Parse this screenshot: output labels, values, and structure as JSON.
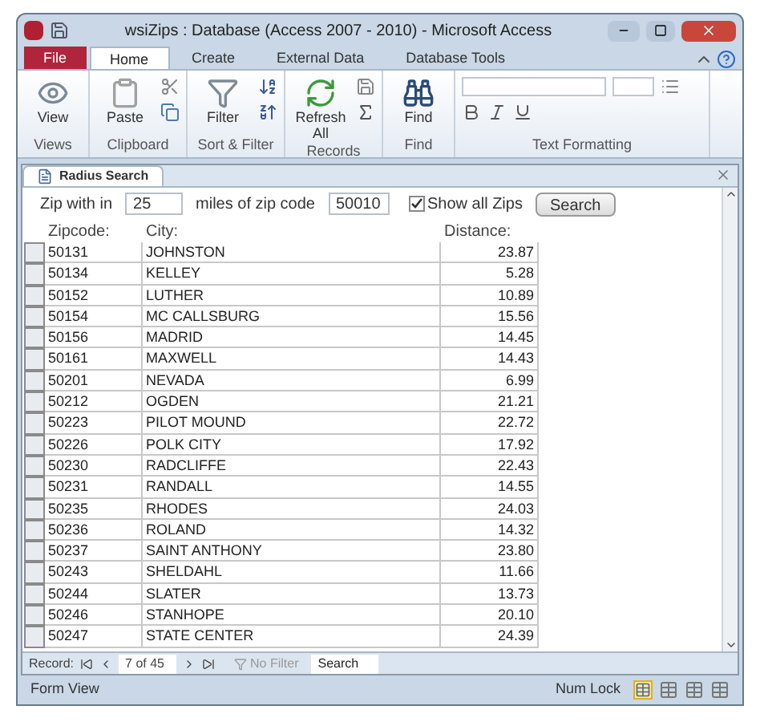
{
  "window": {
    "title": "wsiZips : Database (Access 2007 - 2010)  -  Microsoft Access"
  },
  "ribbon_tabs": [
    {
      "label": "File",
      "kind": "file",
      "selected": false
    },
    {
      "label": "Home",
      "kind": "tab",
      "selected": true
    },
    {
      "label": "Create",
      "kind": "tab",
      "selected": false
    },
    {
      "label": "External Data",
      "kind": "tab",
      "selected": false
    },
    {
      "label": "Database Tools",
      "kind": "tab",
      "selected": false
    }
  ],
  "ribbon_groups": [
    {
      "label": "Views",
      "button": "View",
      "kind": "view"
    },
    {
      "label": "Clipboard",
      "button": "Paste",
      "kind": "paste"
    },
    {
      "label": "Sort & Filter",
      "button": "Filter",
      "kind": "filter"
    },
    {
      "label": "Records",
      "button": "Refresh All",
      "kind": "refresh"
    },
    {
      "label": "Find",
      "button": "Find",
      "kind": "find"
    },
    {
      "label": "Text Formatting",
      "kind": "text"
    }
  ],
  "document_tab": {
    "label": "Radius Search"
  },
  "form": {
    "zip_within_label": "Zip with in",
    "miles_value": "25",
    "miles_label": "miles of zip code",
    "zip_value": "50010",
    "show_all": {
      "label": "Show all Zips",
      "checked": true
    },
    "search_button": "Search"
  },
  "table": {
    "columns": [
      "Zipcode:",
      "City:",
      "Distance:"
    ],
    "rows": [
      [
        "50131",
        "JOHNSTON",
        "23.87"
      ],
      [
        "50134",
        "KELLEY",
        "5.28"
      ],
      [
        "50152",
        "LUTHER",
        "10.89"
      ],
      [
        "50154",
        "MC CALLSBURG",
        "15.56"
      ],
      [
        "50156",
        "MADRID",
        "14.45"
      ],
      [
        "50161",
        "MAXWELL",
        "14.43"
      ],
      [
        "50201",
        "NEVADA",
        "6.99"
      ],
      [
        "50212",
        "OGDEN",
        "21.21"
      ],
      [
        "50223",
        "PILOT MOUND",
        "22.72"
      ],
      [
        "50226",
        "POLK CITY",
        "17.92"
      ],
      [
        "50230",
        "RADCLIFFE",
        "22.43"
      ],
      [
        "50231",
        "RANDALL",
        "14.55"
      ],
      [
        "50235",
        "RHODES",
        "24.03"
      ],
      [
        "50236",
        "ROLAND",
        "14.32"
      ],
      [
        "50237",
        "SAINT ANTHONY",
        "23.80"
      ],
      [
        "50243",
        "SHELDAHL",
        "11.66"
      ],
      [
        "50244",
        "SLATER",
        "13.73"
      ],
      [
        "50246",
        "STANHOPE",
        "20.10"
      ],
      [
        "50247",
        "STATE CENTER",
        "24.39"
      ]
    ]
  },
  "navigation": {
    "label": "Record:",
    "position": "7 of 45",
    "filter": "No Filter",
    "search": "Search"
  },
  "status_bar": {
    "left": "Form View",
    "num_lock": "Num Lock"
  }
}
